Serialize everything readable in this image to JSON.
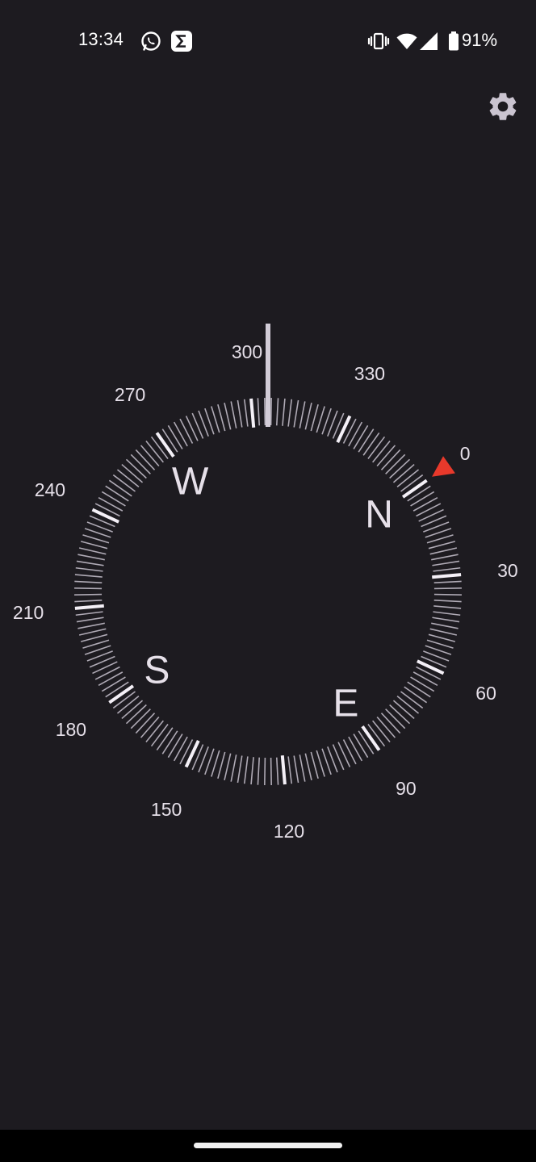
{
  "status_bar": {
    "time": "13:34",
    "notification_icons": [
      "whatsapp-icon",
      "sigma-app-icon"
    ],
    "system_icons": [
      "vibrate-icon",
      "wifi-icon",
      "cellular-signal-icon",
      "battery-icon"
    ],
    "battery_percent": "91%"
  },
  "toolbar": {
    "settings_icon": "gear-icon"
  },
  "compass": {
    "cardinals": [
      {
        "label": "N",
        "bearing": 0
      },
      {
        "label": "E",
        "bearing": 90
      },
      {
        "label": "S",
        "bearing": 180
      },
      {
        "label": "W",
        "bearing": 270
      }
    ],
    "degree_labels": [
      "0",
      "30",
      "60",
      "90",
      "120",
      "150",
      "180",
      "210",
      "240",
      "270",
      "300",
      "330"
    ],
    "heading_degrees": 305,
    "north_marker_color": "#e8392b",
    "tick_color": "#c9c3cf",
    "text_color": "#e6e0e9"
  }
}
